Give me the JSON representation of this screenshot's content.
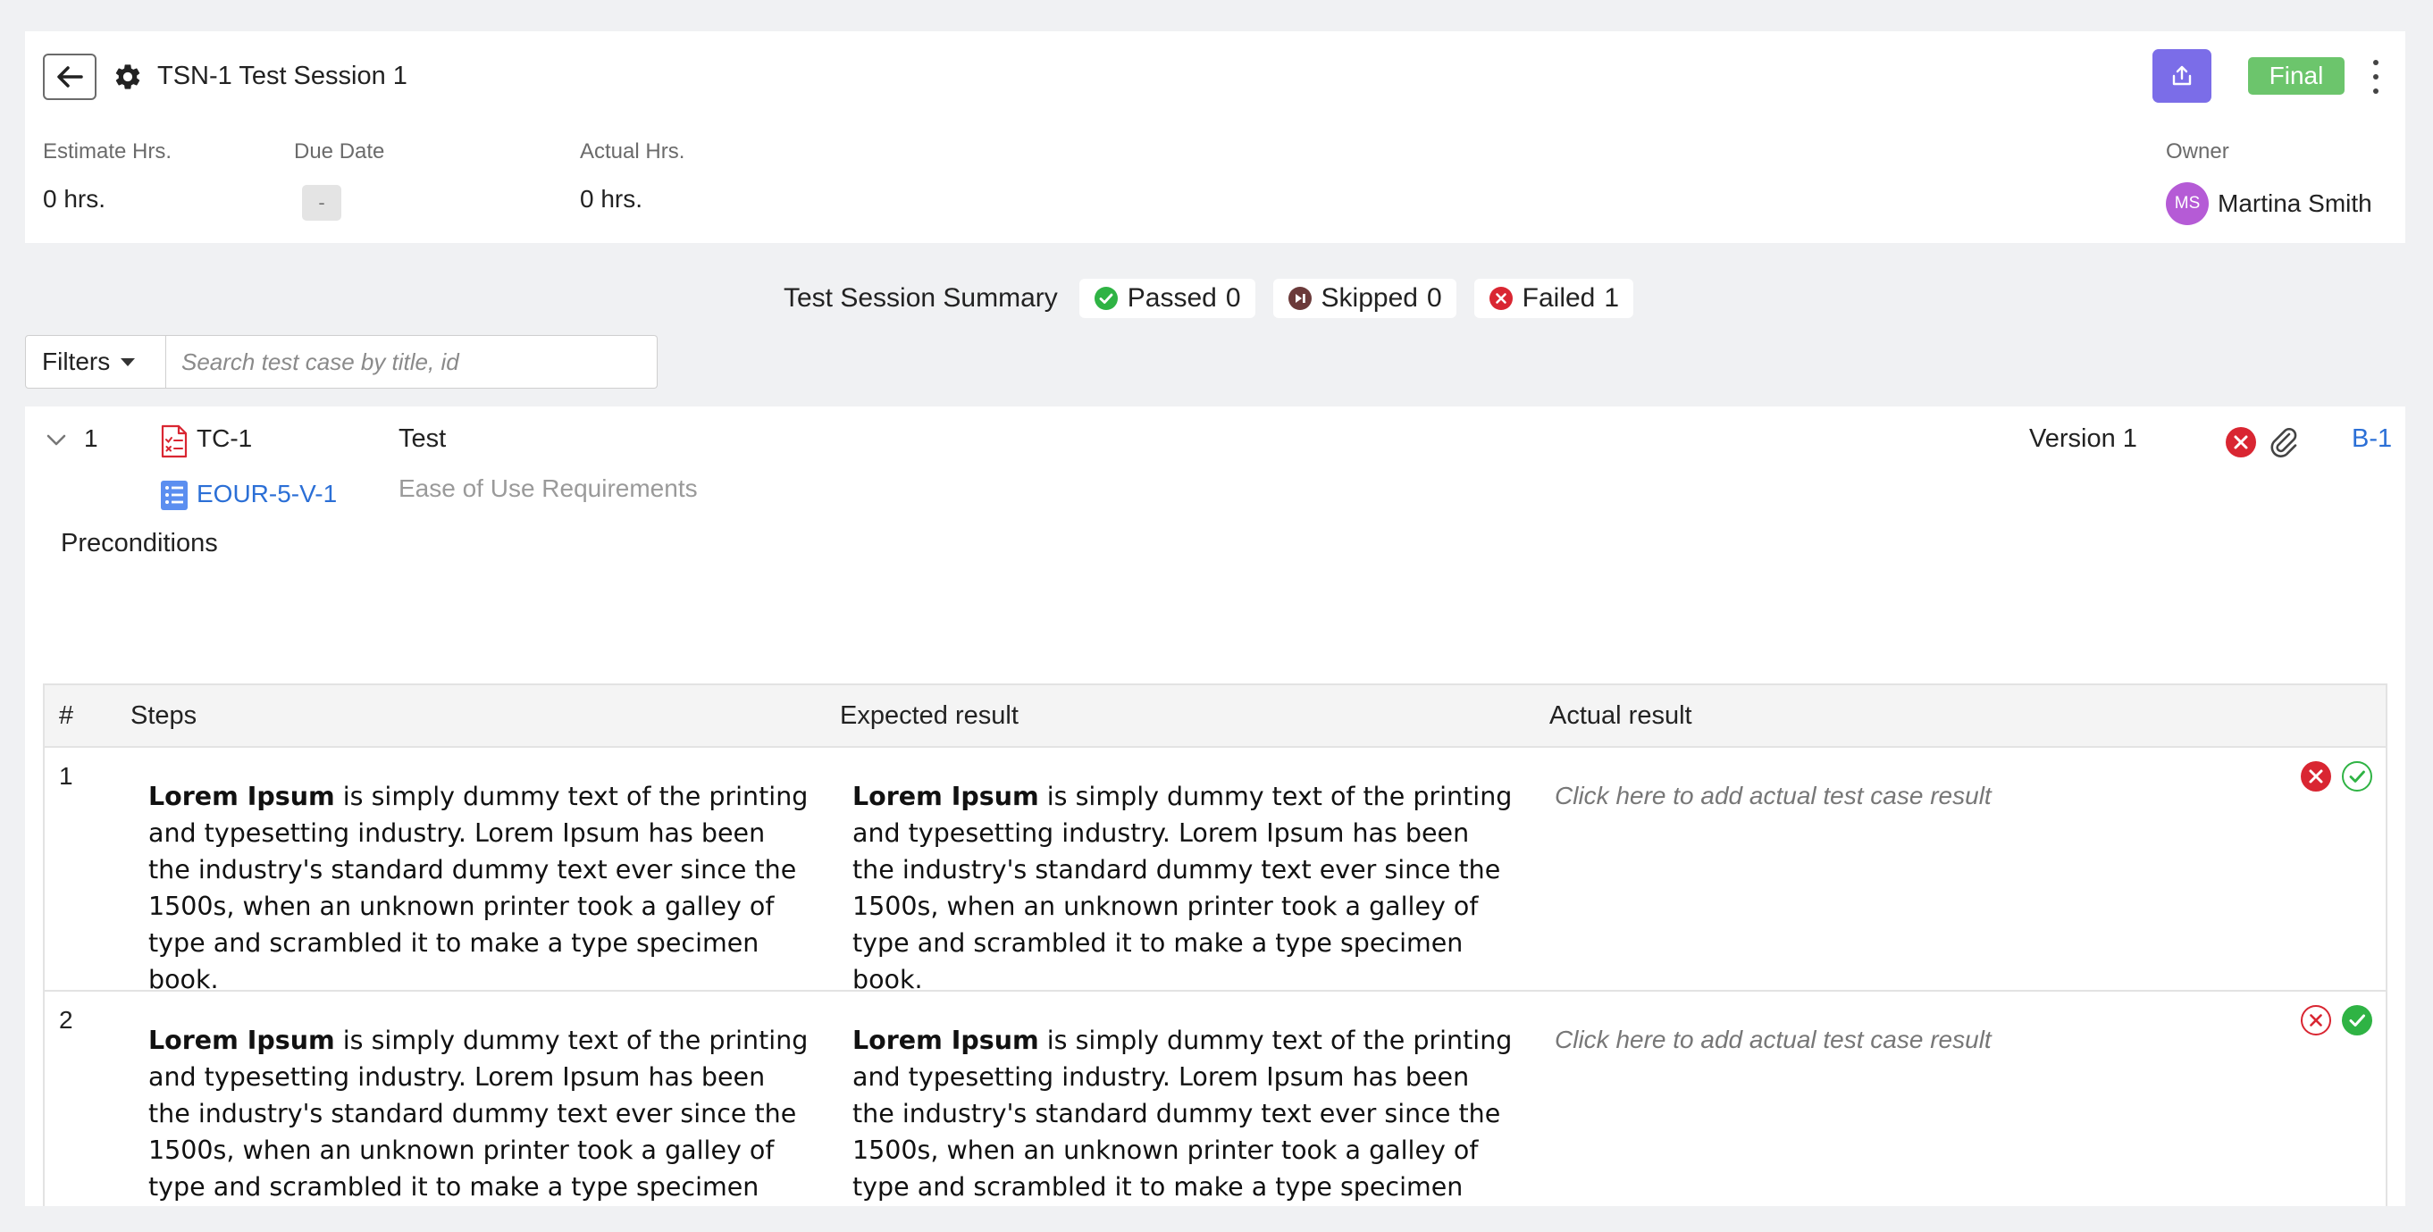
{
  "header": {
    "title": "TSN-1 Test Session 1",
    "status": "Final",
    "fields": [
      {
        "label": "Estimate Hrs.",
        "value": "0 hrs."
      },
      {
        "label": "Due Date",
        "value": "-"
      },
      {
        "label": "Actual Hrs.",
        "value": "0 hrs."
      }
    ],
    "owner": {
      "label": "Owner",
      "initials": "MS",
      "name": "Martina Smith"
    }
  },
  "summary": {
    "title": "Test Session Summary",
    "items": [
      {
        "label": "Passed",
        "count": "0"
      },
      {
        "label": "Skipped",
        "count": "0"
      },
      {
        "label": "Failed",
        "count": "1"
      }
    ]
  },
  "filters": {
    "label": "Filters"
  },
  "search": {
    "placeholder": "Search test case by title, id"
  },
  "test_case": {
    "index": "1",
    "id": "TC-1",
    "title": "Test",
    "requirement_id": "EOUR-5-V-1",
    "requirement_title": "Ease of Use Requirements",
    "version": "Version 1",
    "bug_link": "B-1",
    "preconditions_label": "Preconditions"
  },
  "steps_table": {
    "columns": {
      "num": "#",
      "steps": "Steps",
      "expected": "Expected result",
      "actual": "Actual result"
    },
    "rows": [
      {
        "num": "1",
        "step_bold": "Lorem Ipsum",
        "step_text": " is simply dummy text of the printing and typesetting industry. Lorem Ipsum has been the industry's standard dummy text ever since the 1500s, when an unknown printer took a galley of type and scrambled it to make a type specimen book.",
        "expected_bold": "Lorem Ipsum",
        "expected_text": " is simply dummy text of the printing and typesetting industry. Lorem Ipsum has been the industry's standard dummy text ever since the 1500s, when an unknown printer took a galley of type and scrambled it to make a type specimen book.",
        "actual_placeholder": "Click here to add actual test case result",
        "result": "failed"
      },
      {
        "num": "2",
        "step_bold": "Lorem Ipsum",
        "step_text": " is simply dummy text of the printing and typesetting industry. Lorem Ipsum has been the industry's standard dummy text ever since the 1500s, when an unknown printer took a galley of type and scrambled it to make a type specimen book.",
        "expected_bold": "Lorem Ipsum",
        "expected_text": " is simply dummy text of the printing and typesetting industry. Lorem Ipsum has been the industry's standard dummy text ever since the 1500s, when an unknown printer took a galley of type and scrambled it to make a type specimen book.",
        "actual_placeholder": "Click here to add actual test case result",
        "result": "passed"
      }
    ]
  },
  "colors": {
    "accent": "#7b6de8",
    "final": "#6cc56c",
    "passed": "#2fb344",
    "skipped": "#6b3a3a",
    "failed": "#d92632",
    "link": "#2b6fd6",
    "avatar": "#b55bd6"
  },
  "icons": [
    "back-arrow-icon",
    "gear-icon",
    "share-icon",
    "kebab-icon",
    "check-circle-icon",
    "skip-icon",
    "x-circle-icon",
    "chevron-down-icon",
    "test-case-icon",
    "requirement-list-icon",
    "paperclip-icon"
  ]
}
